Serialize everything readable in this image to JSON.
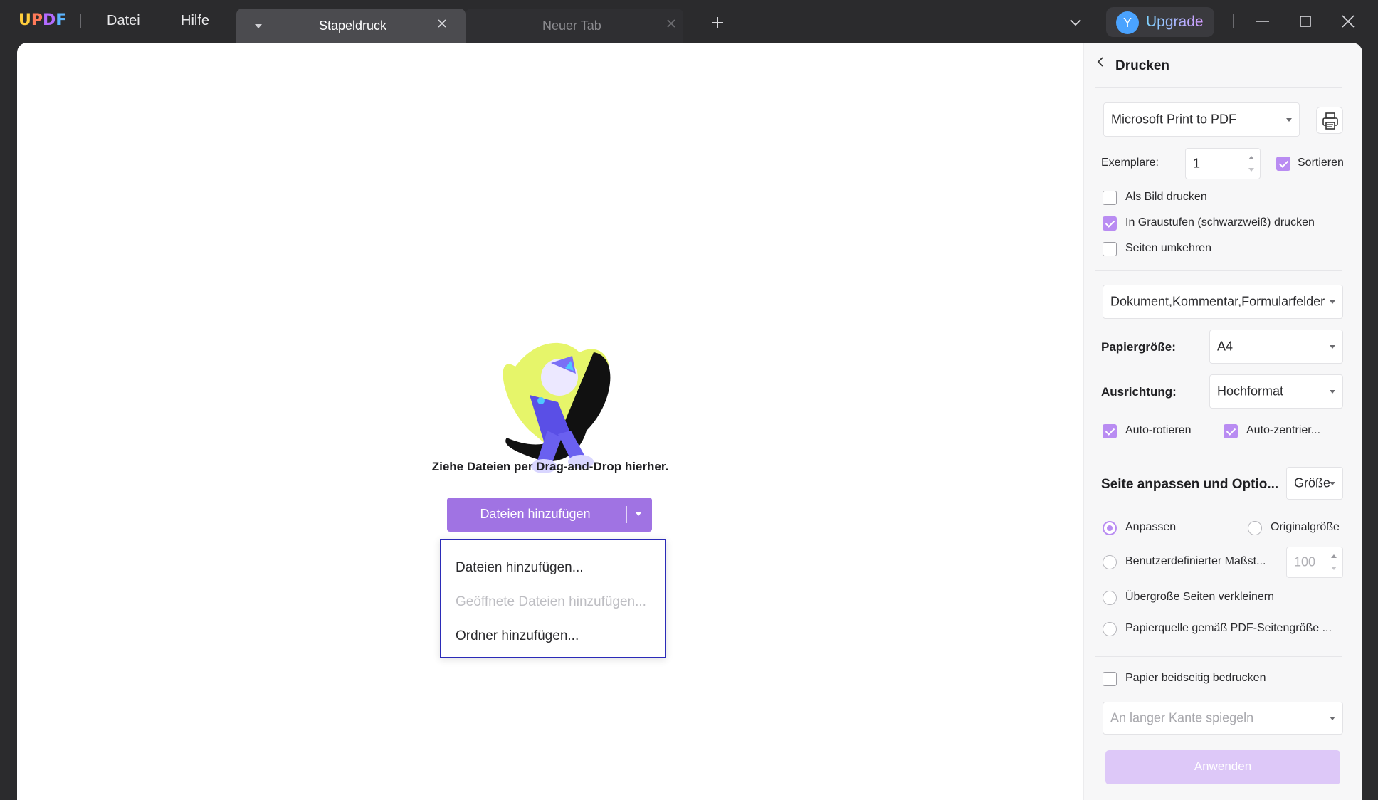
{
  "app": {
    "logo_text": "UPDF",
    "menu": {
      "file": "Datei",
      "help": "Hilfe"
    },
    "tabs": [
      {
        "label": "Stapeldruck",
        "active": true
      },
      {
        "label": "Neuer Tab",
        "active": false
      }
    ],
    "upgrade": {
      "avatar_letter": "Y",
      "label": "Upgrade"
    }
  },
  "main": {
    "drop_text": "Ziehe Dateien per Drag-and-Drop hierher.",
    "add_button_label": "Dateien hinzufügen",
    "dropdown": [
      {
        "label": "Dateien hinzufügen...",
        "enabled": true
      },
      {
        "label": "Geöffnete Dateien hinzufügen...",
        "enabled": false
      },
      {
        "label": "Ordner hinzufügen...",
        "enabled": true
      }
    ]
  },
  "panel": {
    "title": "Drucken",
    "printer": "Microsoft Print to PDF",
    "copies_label": "Exemplare:",
    "copies_value": "1",
    "collate_label": "Sortieren",
    "collate_checked": true,
    "options": [
      {
        "label": "Als Bild drucken",
        "checked": false
      },
      {
        "label": "In Graustufen (schwarzweiß) drucken",
        "checked": true
      },
      {
        "label": "Seiten umkehren",
        "checked": false
      }
    ],
    "content_select": "Dokument,Kommentar,Formularfelder",
    "paper_size_label": "Papiergröße:",
    "paper_size_value": "A4",
    "orientation_label": "Ausrichtung:",
    "orientation_value": "Hochformat",
    "auto_rotate_label": "Auto-rotieren",
    "auto_rotate_checked": true,
    "auto_center_label": "Auto-zentrier...",
    "auto_center_checked": true,
    "fit_section_label": "Seite anpassen und Optio...",
    "fit_mode_value": "Größe",
    "radio_fit": "Anpassen",
    "radio_original": "Originalgröße",
    "radio_custom": "Benutzerdefinierter Maßst...",
    "custom_scale_value": "100",
    "radio_shrink": "Übergroße Seiten verkleinern",
    "radio_paper_source": "Papierquelle gemäß PDF-Seitengröße ...",
    "selected_fit": "Anpassen",
    "duplex_label": "Papier beidseitig bedrucken",
    "duplex_checked": false,
    "duplex_mode_placeholder": "An langer Kante spiegeln",
    "apply_label": "Anwenden"
  }
}
